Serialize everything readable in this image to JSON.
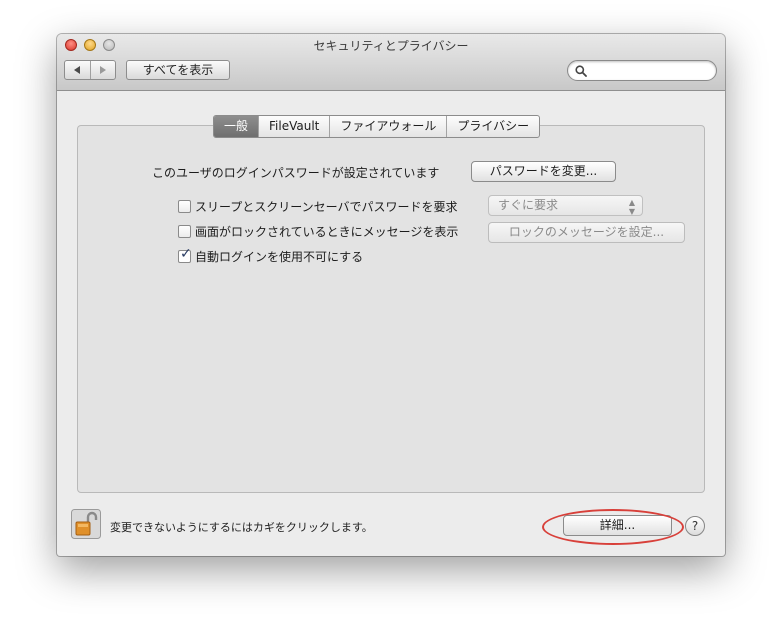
{
  "window": {
    "title": "セキュリティとプライバシー",
    "show_all_label": "すべてを表示",
    "search": {
      "value": "",
      "placeholder": ""
    }
  },
  "tabs": [
    {
      "label": "一般",
      "selected": true
    },
    {
      "label": "FileVault",
      "selected": false
    },
    {
      "label": "ファイアウォール",
      "selected": false
    },
    {
      "label": "プライバシー",
      "selected": false
    }
  ],
  "general": {
    "password_text": "このユーザのログインパスワードが設定されています",
    "change_password_label": "パスワードを変更...",
    "require_password": {
      "label": "スリープとスクリーンセーバでパスワードを要求",
      "checked": false,
      "select_value": "すぐに要求"
    },
    "lock_message": {
      "label": "画面がロックされているときにメッセージを表示",
      "checked": false,
      "button_label": "ロックのメッセージを設定..."
    },
    "disable_autologin": {
      "label": "自動ログインを使用不可にする",
      "checked": true
    }
  },
  "footer": {
    "lock_text": "変更できないようにするにはカギをクリックします。",
    "advanced_label": "詳細...",
    "help_label": "?"
  },
  "colors": {
    "annotation": "#d8403a",
    "selected_tab": "#7d7d7d"
  }
}
